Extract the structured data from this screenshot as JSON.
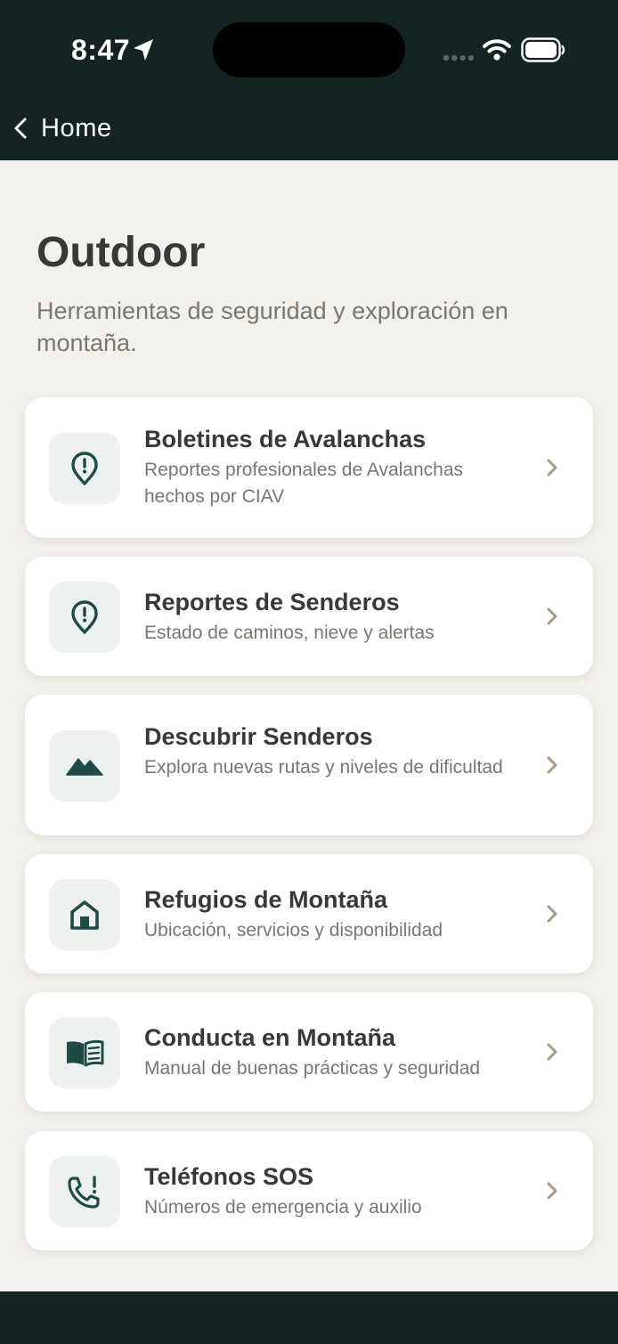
{
  "status_bar": {
    "time": "8:47"
  },
  "nav": {
    "back_label": "Home"
  },
  "page": {
    "title": "Outdoor",
    "subtitle": "Herramientas de seguridad y exploración en montaña."
  },
  "colors": {
    "header_bg": "#132423",
    "page_bg": "#F3F1EB",
    "card_bg": "#FFFFFF",
    "icon_tile_bg": "#EDF1EF",
    "icon_accent": "#1F4B47",
    "chevron": "#A79A82",
    "title_text": "#383838",
    "secondary_text": "#7A7670"
  },
  "items": [
    {
      "title": "Boletines de Avalanchas",
      "description": "Reportes profesionales de Avalanchas hechos por CIAV",
      "icon": "map-pin-alert-icon"
    },
    {
      "title": "Reportes de Senderos",
      "description": "Estado de caminos, nieve y alertas",
      "icon": "map-pin-alert-icon"
    },
    {
      "title": "Descubrir Senderos",
      "description": "Explora nuevas rutas y niveles de dificultad",
      "icon": "mountain-icon"
    },
    {
      "title": "Refugios de Montaña",
      "description": "Ubicación, servicios y disponibilidad",
      "icon": "house-icon"
    },
    {
      "title": "Conducta en Montaña",
      "description": "Manual de buenas prácticas y seguridad",
      "icon": "open-book-icon"
    },
    {
      "title": "Teléfonos SOS",
      "description": "Números de emergencia y auxilio",
      "icon": "phone-alert-icon"
    }
  ]
}
